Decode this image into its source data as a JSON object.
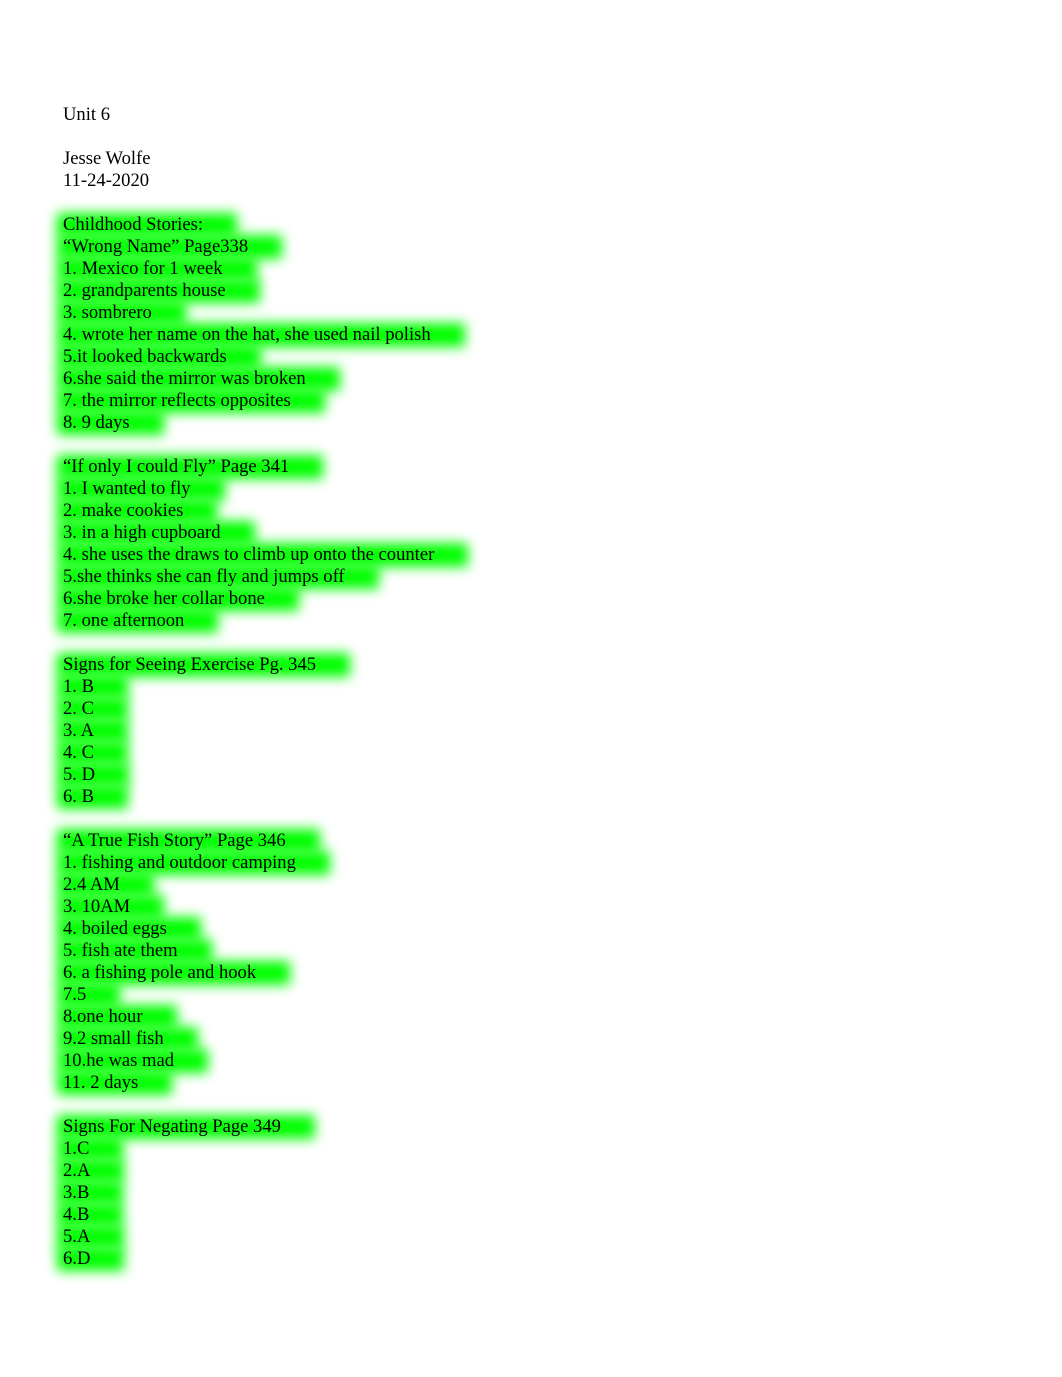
{
  "header": {
    "unit": "Unit 6",
    "name": "Jesse Wolfe",
    "date": "11-24-2020"
  },
  "highlight_color": "#00ff00",
  "sections": [
    {
      "lines": [
        "Childhood Stories:",
        "“Wrong Name” Page338",
        "1. Mexico for 1 week",
        "2. grandparents house",
        "3. sombrero",
        "4. wrote her name on the hat, she used nail polish",
        "5.it looked backwards",
        "6.she said the mirror was broken",
        "7. the mirror reflects opposites",
        "8. 9 days"
      ]
    },
    {
      "lines": [
        "“If only I could Fly” Page 341",
        "1. I wanted to fly",
        "2. make cookies",
        "3. in a high cupboard",
        "4. she uses the draws to climb up onto the counter",
        "5.she thinks she can fly and jumps off",
        "6.she broke her collar bone",
        "7. one afternoon"
      ]
    },
    {
      "lines": [
        "Signs for Seeing Exercise Pg. 345",
        "1. B",
        "2. C",
        "3. A",
        "4. C",
        "5. D",
        "6. B"
      ]
    },
    {
      "lines": [
        "“A True Fish Story” Page 346",
        "1. fishing and outdoor camping",
        "2.4 AM",
        "3. 10AM",
        "4. boiled eggs",
        "5. fish ate them",
        "6. a fishing pole and hook",
        "7.5",
        "8.one hour",
        "9.2 small fish",
        "10.he was mad",
        "11. 2 days"
      ]
    },
    {
      "lines": [
        "Signs For Negating Page 349",
        "1.C",
        "2.A",
        "3.B",
        "4.B",
        "5.A",
        "6.D"
      ]
    }
  ]
}
